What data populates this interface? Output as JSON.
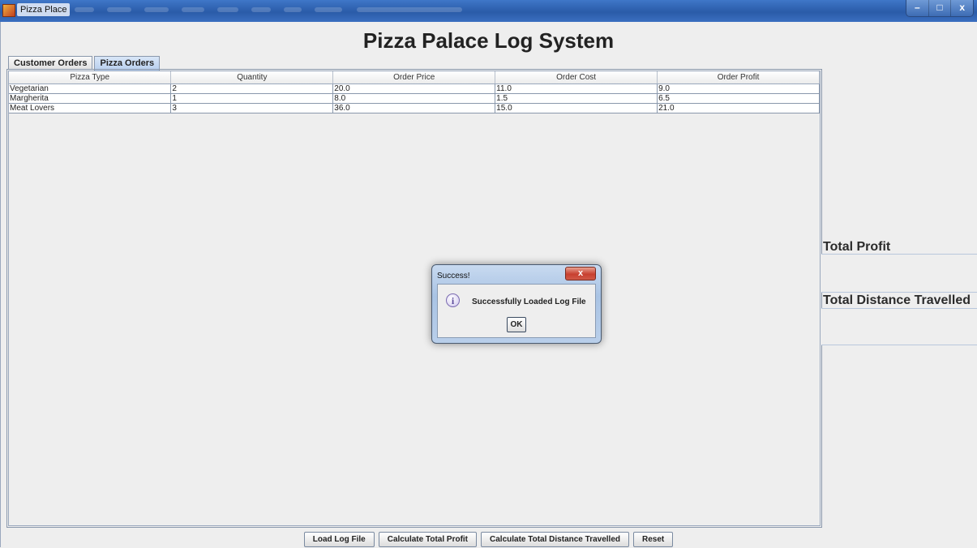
{
  "window": {
    "title": "Pizza Place"
  },
  "app": {
    "title": "Pizza Palace Log System"
  },
  "tabs": [
    {
      "label": "Customer Orders",
      "active": false
    },
    {
      "label": "Pizza Orders",
      "active": true
    }
  ],
  "table": {
    "columns": [
      "Pizza Type",
      "Quantity",
      "Order Price",
      "Order Cost",
      "Order Profit"
    ],
    "rows": [
      [
        "Vegetarian",
        "2",
        "20.0",
        "11.0",
        "9.0"
      ],
      [
        "Margherita",
        "1",
        "8.0",
        "1.5",
        "6.5"
      ],
      [
        "Meat Lovers",
        "3",
        "36.0",
        "15.0",
        "21.0"
      ]
    ]
  },
  "side": {
    "total_profit_label": "Total Profit",
    "total_distance_label": "Total Distance Travelled"
  },
  "buttons": {
    "load": "Load Log File",
    "calc_profit": "Calculate Total Profit",
    "calc_distance": "Calculate Total Distance Travelled",
    "reset": "Reset"
  },
  "dialog": {
    "title": "Success!",
    "message": "Successfully Loaded Log File",
    "ok": "OK",
    "close_glyph": "x",
    "icon_glyph": "i"
  },
  "window_controls": {
    "minimize": "–",
    "maximize": "□",
    "close": "x"
  },
  "colors": {
    "title_bar": "#2a5ba8",
    "panel_bg": "#eeeeee",
    "close_red": "#c84030"
  }
}
